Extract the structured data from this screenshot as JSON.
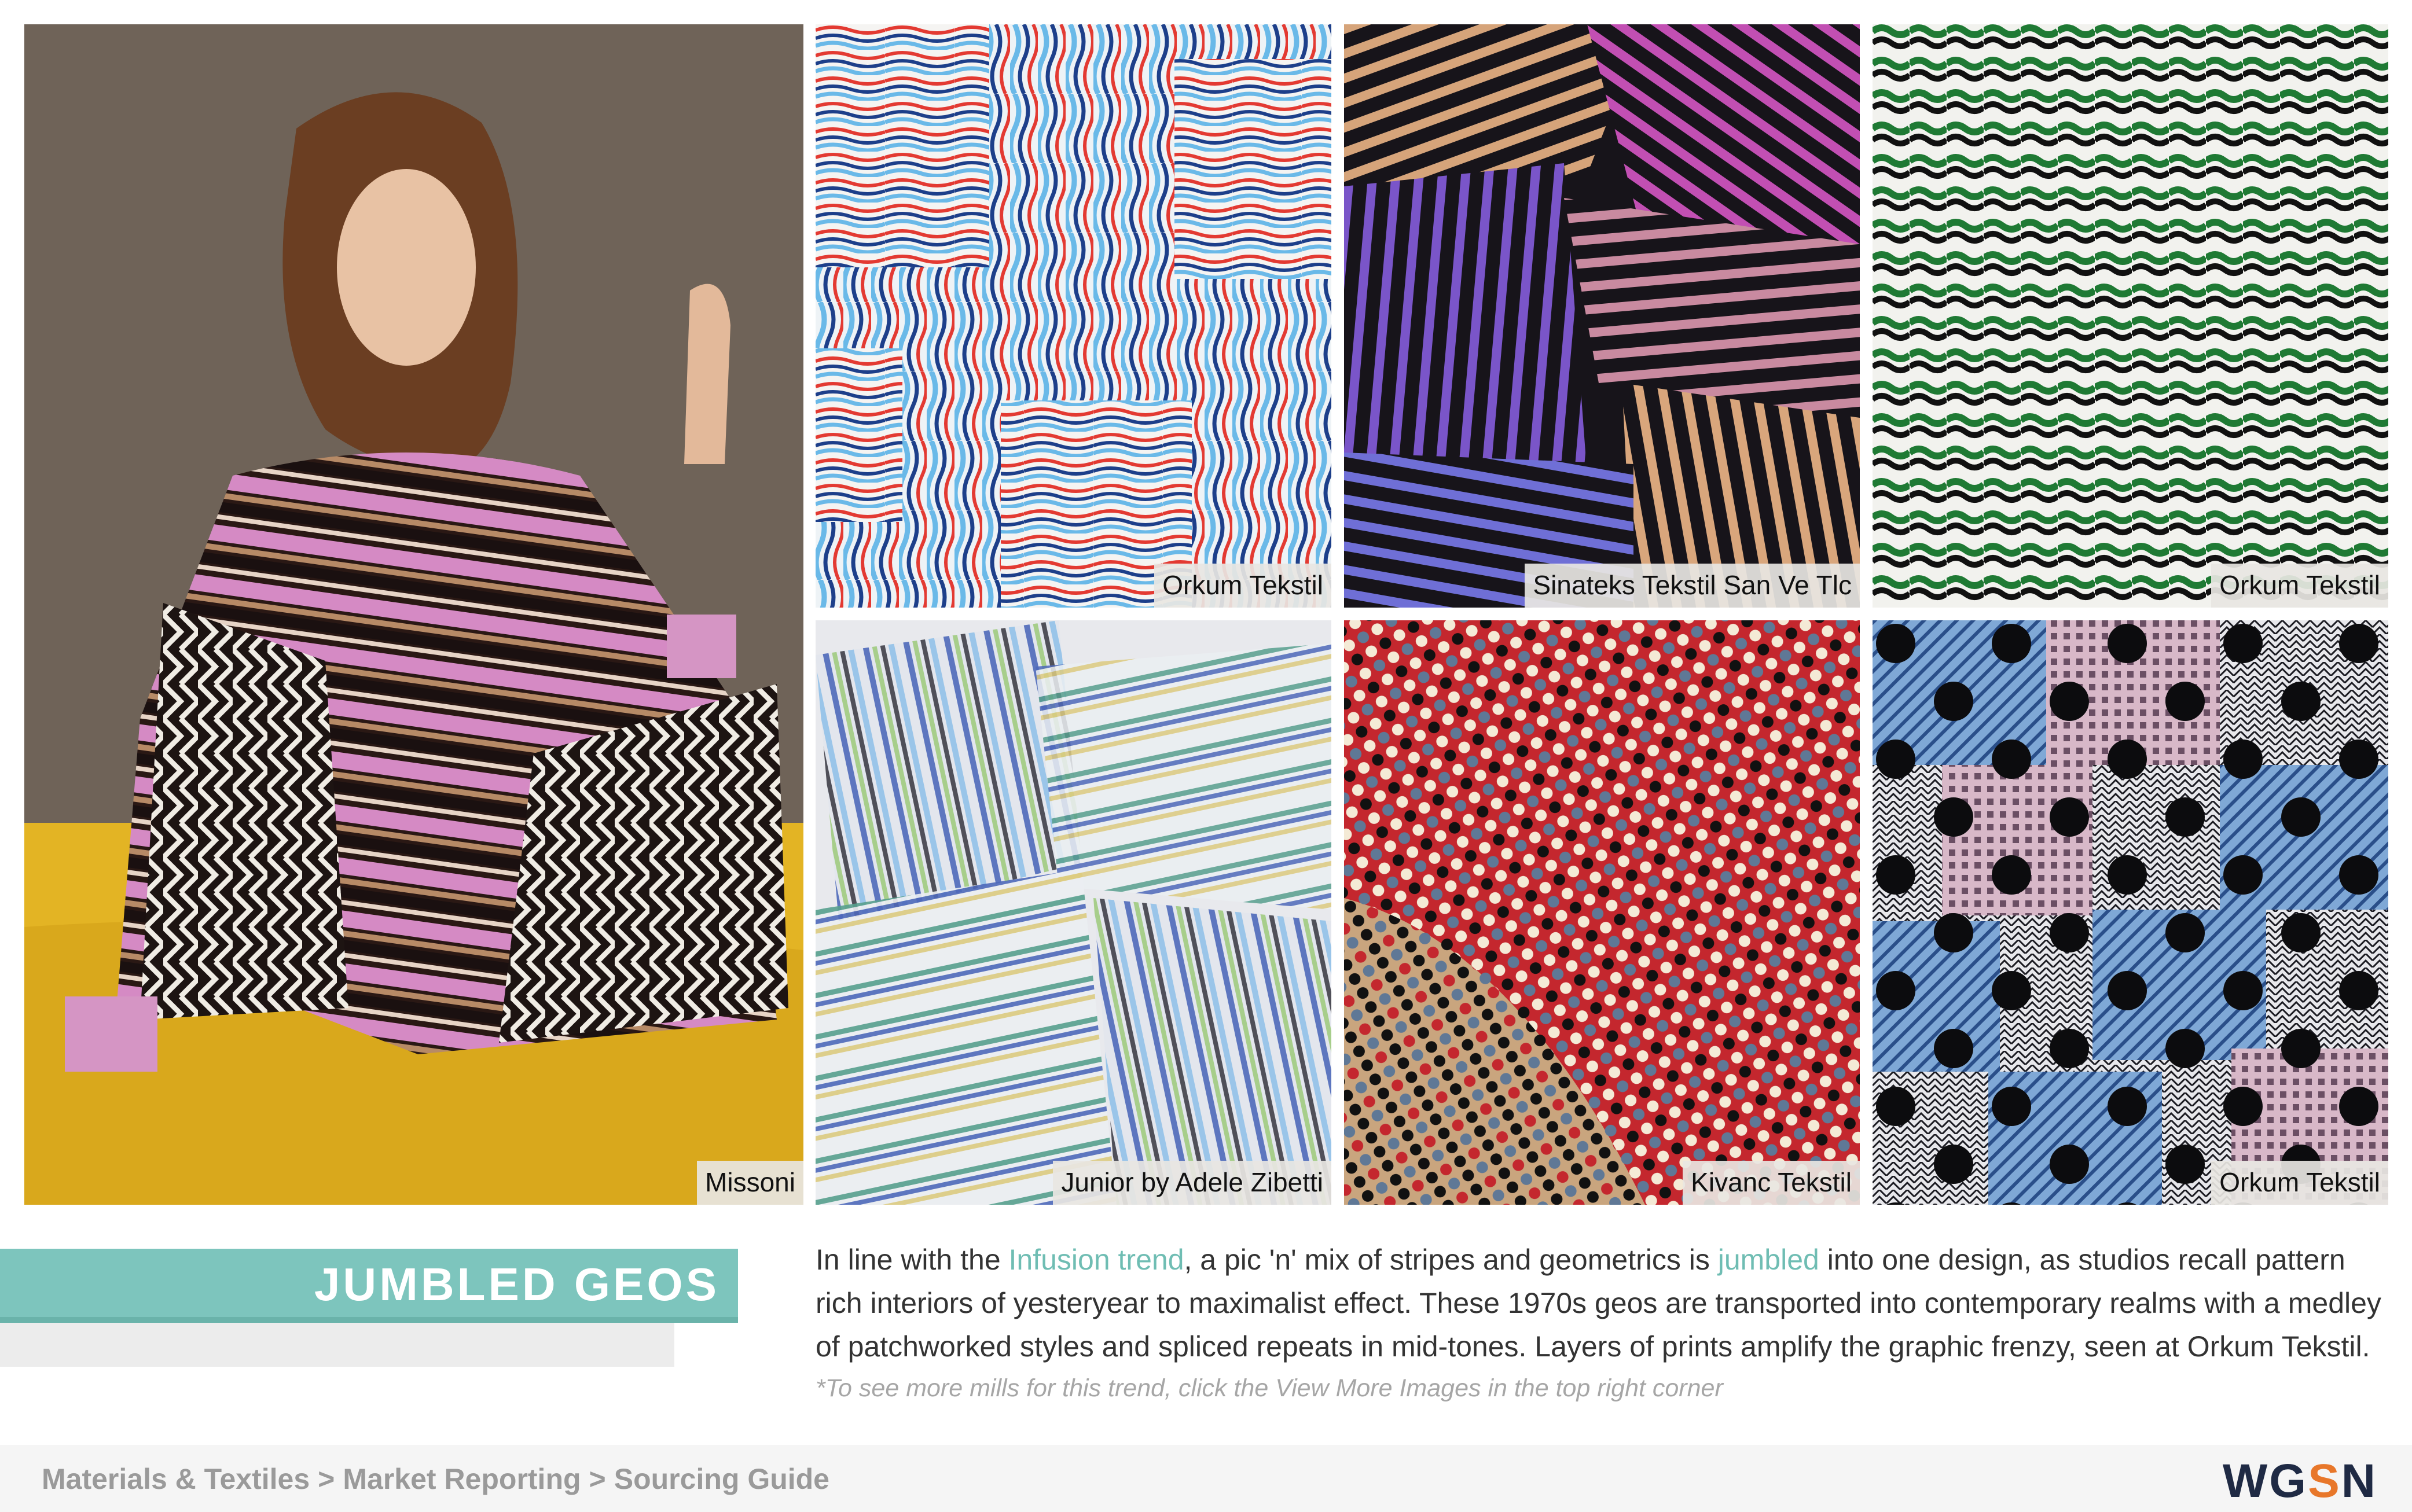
{
  "photos": {
    "model": {
      "credit": "Missoni",
      "subject": "model-in-striped-knit-dress"
    },
    "tile_1": {
      "credit": "Orkum Tekstil",
      "subject": "wavy-stripe-patchwork-blue-red"
    },
    "tile_2": {
      "credit": "Sinateks Tekstil San Ve Tlc",
      "subject": "multicolour-stripe-knit"
    },
    "tile_3": {
      "credit": "Orkum Tekstil",
      "subject": "green-wave-geo"
    },
    "tile_4": {
      "credit": "Junior by Adele Zibetti",
      "subject": "sheer-stripe-patchwork"
    },
    "tile_5": {
      "credit": "Kivanc Tekstil",
      "subject": "dot-grid-knit"
    },
    "tile_6": {
      "credit": "Orkum Tekstil",
      "subject": "polka-dot-patchwork"
    }
  },
  "title": "JUMBLED GEOS",
  "description": {
    "part1": "In line with the ",
    "link1": "Infusion trend",
    "part2": ", a pic 'n' mix of stripes and geometrics is ",
    "link2": "jumbled",
    "part3": " into one design, as studios recall pattern rich interiors of yesteryear to maximalist effect. These 1970s geos are transported into contemporary realms with a medley of patchworked styles and spliced repeats in mid-tones. Layers of prints amplify the graphic frenzy, seen at Orkum Tekstil."
  },
  "note": "*To see more mills for this trend, click the View More Images in the top right corner",
  "footer": {
    "breadcrumb": [
      "Materials & Textiles",
      "Market Reporting",
      "Sourcing Guide"
    ],
    "separator": ">",
    "logo": {
      "part1": "WG",
      "part2": "S",
      "part3": "N"
    }
  },
  "colors": {
    "accent": "#7dc5bd",
    "link": "#6fbdb3",
    "logo_dark": "#1f2a44",
    "logo_accent": "#e8772a"
  }
}
